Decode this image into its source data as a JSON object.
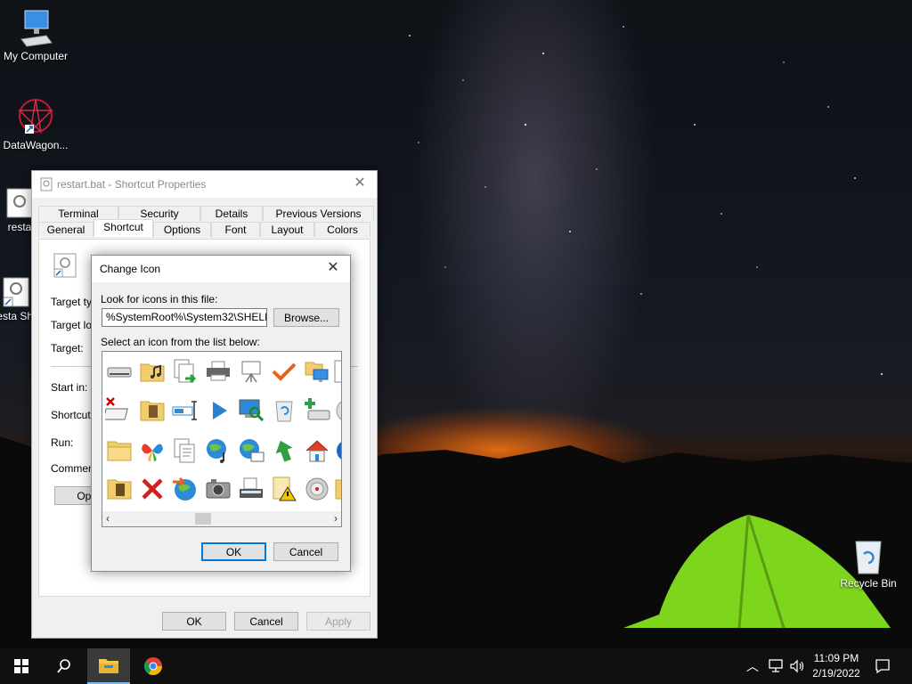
{
  "desktop": {
    "icons": [
      {
        "label": "My Computer"
      },
      {
        "label": "DataWagon..."
      },
      {
        "label": "resta"
      },
      {
        "label": "resta Sho"
      },
      {
        "label": "Recycle Bin"
      }
    ]
  },
  "properties_window": {
    "title": "restart.bat - Shortcut Properties",
    "tabs_back": [
      "Terminal",
      "Security",
      "Details",
      "Previous Versions"
    ],
    "tabs_front": [
      "General",
      "Shortcut",
      "Options",
      "Font",
      "Layout",
      "Colors"
    ],
    "active_tab": "Shortcut",
    "fields": {
      "target_type": "Target typ",
      "target_location": "Target loc",
      "target": "Target:",
      "start_in": "Start in:",
      "shortcut_key": "Shortcut k",
      "run": "Run:",
      "comment": "Comment:"
    },
    "open_button": "Open",
    "ok": "OK",
    "cancel": "Cancel",
    "apply": "Apply"
  },
  "change_icon_dialog": {
    "title": "Change Icon",
    "look_label": "Look for icons in this file:",
    "file_path": "%SystemRoot%\\System32\\SHELL32",
    "browse": "Browse...",
    "select_label": "Select an icon from the list below:",
    "ok": "OK",
    "cancel": "Cancel",
    "icons": [
      "drive-icon",
      "music-folder-icon",
      "copy-to-icon",
      "printer-icon",
      "presentation-icon",
      "checkmark-icon",
      "network-folder-icon",
      "document-partial-icon",
      "disk-error-icon",
      "media-folder-icon",
      "text-cursor-icon",
      "play-icon",
      "monitor-search-icon",
      "recycle-full-icon",
      "add-drive-icon",
      "disc-partial-icon",
      "folder-icon",
      "msn-butterfly-icon",
      "documents-icon",
      "globe-music-icon",
      "globe-picture-icon",
      "arrow-up-icon",
      "home-network-icon",
      "globe-partial-icon",
      "media-folder-2-icon",
      "red-x-icon",
      "globe-arrow-icon",
      "camera-icon",
      "scanner-icon",
      "warning-folder-icon",
      "speaker-disc-icon",
      "folder-partial-icon"
    ]
  },
  "taskbar": {
    "time": "11:09 PM",
    "date": "2/19/2022"
  }
}
